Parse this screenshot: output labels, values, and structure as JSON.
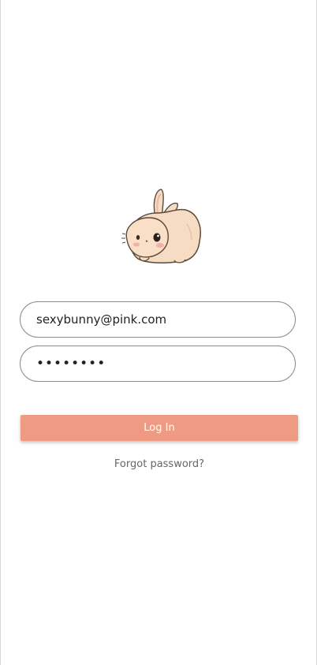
{
  "login": {
    "logo_icon": "bunny-icon",
    "email_value": "sexybunny@pink.com",
    "password_value": "••••••••",
    "login_label": "Log In",
    "forgot_label": "Forgot password?"
  },
  "colors": {
    "accent": "#ef9a82",
    "bunny_body": "#f6dcc2",
    "field_border": "#8a8a8a"
  }
}
